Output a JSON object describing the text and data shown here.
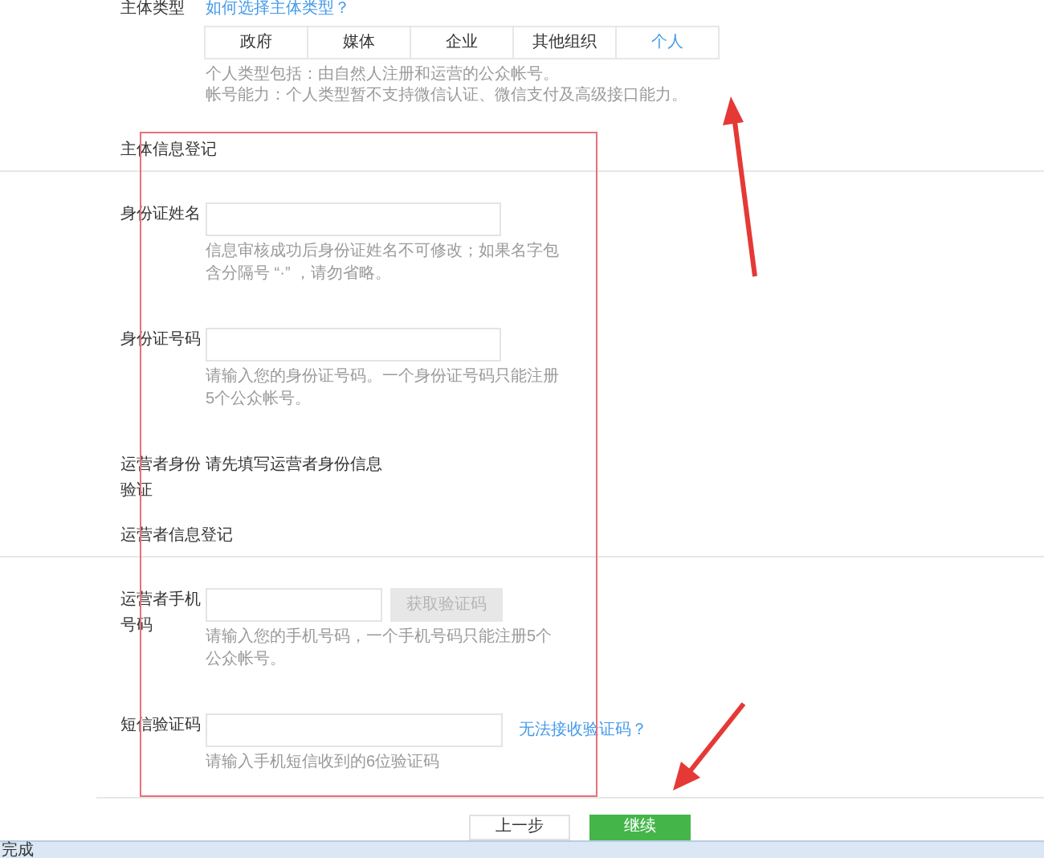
{
  "entity_type": {
    "label": "主体类型",
    "help_link": "如何选择主体类型？",
    "tabs": [
      {
        "label": "政府",
        "selected": false
      },
      {
        "label": "媒体",
        "selected": false
      },
      {
        "label": "企业",
        "selected": false
      },
      {
        "label": "其他组织",
        "selected": false
      },
      {
        "label": "个人",
        "selected": true
      }
    ],
    "notes": [
      "个人类型包括：由自然人注册和运营的公众帐号。",
      "帐号能力：个人类型暂不支持微信认证、微信支付及高级接口能力。"
    ]
  },
  "subject_section": {
    "title": "主体信息登记",
    "fields": [
      {
        "kind": "input",
        "label": "身份证姓名",
        "hint": "信息审核成功后身份证姓名不可修改；如果名字包含分隔号 “·” ，请勿省略。"
      },
      {
        "kind": "input",
        "label": "身份证号码",
        "hint": "请输入您的身份证号码。一个身份证号码只能注册5个公众帐号。"
      },
      {
        "kind": "text",
        "label": "运营者身份验证",
        "value": "请先填写运营者身份信息"
      }
    ]
  },
  "operator_section": {
    "title": "运营者信息登记",
    "fields": [
      {
        "kind": "phone",
        "label": "运营者手机号码",
        "button": {
          "label": "获取验证码",
          "disabled": true
        },
        "hint": "请输入您的手机号码，一个手机号码只能注册5个公众帐号。"
      },
      {
        "kind": "code",
        "label": "短信验证码",
        "link": "无法接收验证码？",
        "hint": "请输入手机短信收到的6位验证码"
      }
    ]
  },
  "actions": [
    {
      "label": "上一步",
      "primary": false
    },
    {
      "label": "继续",
      "primary": true
    }
  ],
  "status_bar": {
    "text": "完成"
  }
}
